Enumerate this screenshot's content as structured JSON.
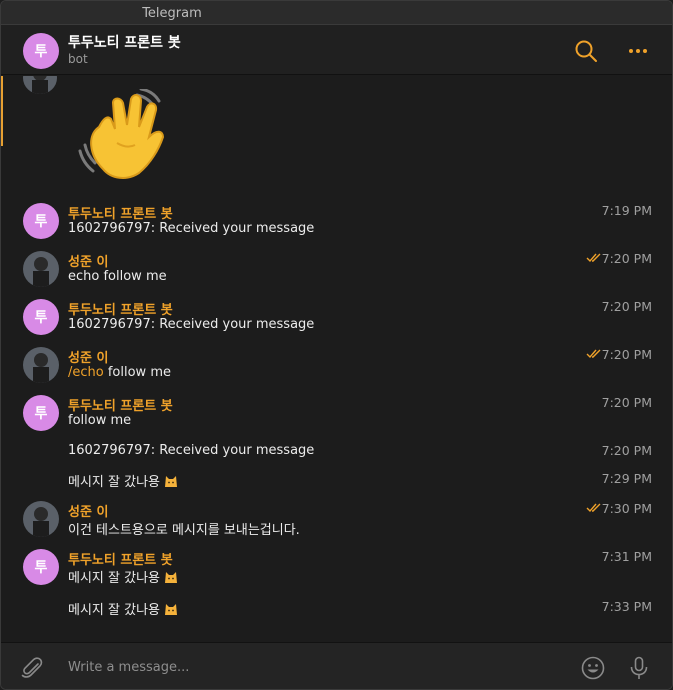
{
  "window": {
    "title": "Telegram"
  },
  "header": {
    "avatar_letter": "투",
    "chat_name": "투두노티 프론트 봇",
    "status": "bot"
  },
  "colors": {
    "accent": "#f0a22a",
    "bot_avatar": "#d88ae6",
    "background": "#1c1c1c"
  },
  "messages": [
    {
      "sender": "투두노티 프론트 봇",
      "avatar": "bot",
      "text": "1602796797: Received your message",
      "time": "7:19 PM",
      "read": false
    },
    {
      "sender": "성준 이",
      "avatar": "user",
      "text": "echo follow me",
      "time": "7:20 PM",
      "read": true
    },
    {
      "sender": "투두노티 프론트 봇",
      "avatar": "bot",
      "text": "1602796797: Received your message",
      "time": "7:20 PM",
      "read": false
    },
    {
      "sender": "성준 이",
      "avatar": "user",
      "command": "/echo",
      "text": " follow me",
      "time": "7:20 PM",
      "read": true
    },
    {
      "sender": "투두노티 프론트 봇",
      "avatar": "bot",
      "text": "follow me",
      "time": "7:20 PM",
      "read": false
    },
    {
      "text": "1602796797: Received your message",
      "time": "7:20 PM",
      "continuation": true
    },
    {
      "text": "메시지 잘 갔나용",
      "emoji": "cat-face-icon",
      "time": "7:29 PM",
      "continuation": true
    },
    {
      "sender": "성준 이",
      "avatar": "user",
      "text": "이건 테스트용으로 메시지를 보내는겁니다.",
      "time": "7:30 PM",
      "read": true
    },
    {
      "sender": "투두노티 프론트 봇",
      "avatar": "bot",
      "text": "메시지 잘 갔나용",
      "emoji": "cat-face-icon",
      "time": "7:31 PM",
      "read": false
    },
    {
      "text": "메시지 잘 갔나용",
      "emoji": "cat-face-icon",
      "time": "7:33 PM",
      "continuation": true
    }
  ],
  "composer": {
    "placeholder": "Write a message..."
  }
}
